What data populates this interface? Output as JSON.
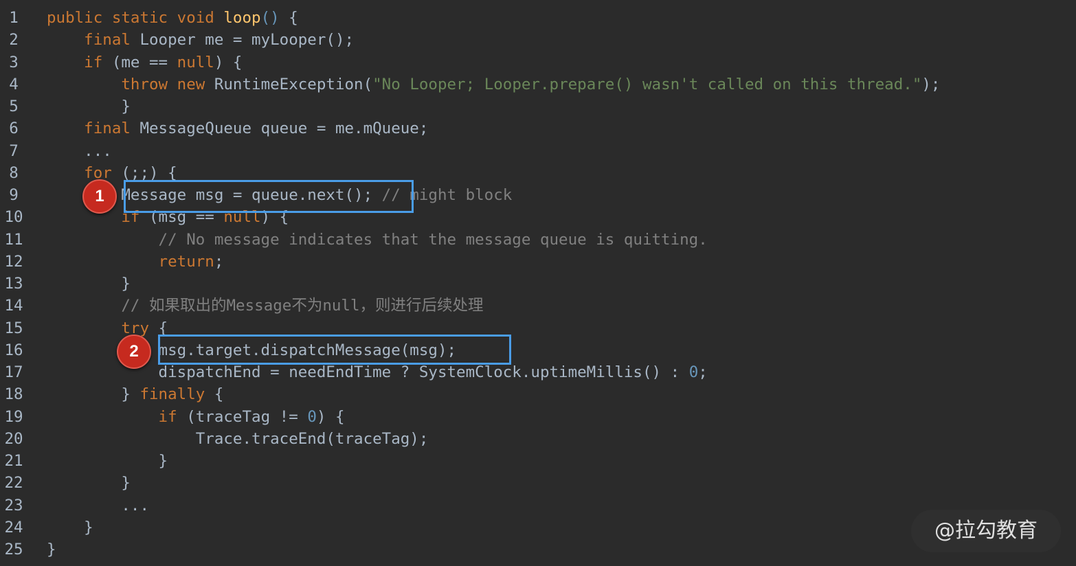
{
  "editor": {
    "theme": {
      "background": "#2b2b2b",
      "keyword": "#cc7832",
      "function": "#ffc66d",
      "string": "#6a8759",
      "number": "#6897bb",
      "comment": "#808080",
      "text": "#a9b7c6",
      "highlight_border": "#4a9de8",
      "marker_fill": "#c62a1f"
    },
    "lines": [
      {
        "n": "1",
        "tokens": [
          {
            "t": "public static void ",
            "c": "kw"
          },
          {
            "t": "loop",
            "c": "fn"
          },
          {
            "t": "()",
            "c": "paren"
          },
          {
            "t": " {",
            "c": "plain"
          }
        ]
      },
      {
        "n": "2",
        "tokens": [
          {
            "t": "    final ",
            "c": "kw"
          },
          {
            "t": "Looper me = myLooper();",
            "c": "plain"
          }
        ]
      },
      {
        "n": "3",
        "tokens": [
          {
            "t": "    if ",
            "c": "kw"
          },
          {
            "t": "(me == ",
            "c": "plain"
          },
          {
            "t": "null",
            "c": "kw"
          },
          {
            "t": ") {",
            "c": "plain"
          }
        ]
      },
      {
        "n": "4",
        "tokens": [
          {
            "t": "        throw new ",
            "c": "kw"
          },
          {
            "t": "RuntimeException(",
            "c": "plain"
          },
          {
            "t": "\"No Looper; Looper.prepare() wasn't called on this thread.\"",
            "c": "str"
          },
          {
            "t": ");",
            "c": "plain"
          }
        ]
      },
      {
        "n": "5",
        "tokens": [
          {
            "t": "        }",
            "c": "plain"
          }
        ]
      },
      {
        "n": "6",
        "tokens": [
          {
            "t": "    final ",
            "c": "kw"
          },
          {
            "t": "MessageQueue queue = me.mQueue;",
            "c": "plain"
          }
        ]
      },
      {
        "n": "7",
        "tokens": [
          {
            "t": "    ...",
            "c": "plain"
          }
        ]
      },
      {
        "n": "8",
        "tokens": [
          {
            "t": "    for ",
            "c": "kw"
          },
          {
            "t": "(;;) {",
            "c": "plain"
          }
        ]
      },
      {
        "n": "9",
        "tokens": [
          {
            "t": "        Message msg = queue.next(); ",
            "c": "plain"
          },
          {
            "t": "// might block",
            "c": "cmt"
          }
        ]
      },
      {
        "n": "10",
        "tokens": [
          {
            "t": "        if ",
            "c": "kw"
          },
          {
            "t": "(msg == ",
            "c": "plain"
          },
          {
            "t": "null",
            "c": "kw"
          },
          {
            "t": ") {",
            "c": "plain"
          }
        ]
      },
      {
        "n": "11",
        "tokens": [
          {
            "t": "            // No message indicates that the message queue is quitting.",
            "c": "cmt"
          }
        ]
      },
      {
        "n": "12",
        "tokens": [
          {
            "t": "            return",
            "c": "kw"
          },
          {
            "t": ";",
            "c": "plain"
          }
        ]
      },
      {
        "n": "13",
        "tokens": [
          {
            "t": "        }",
            "c": "plain"
          }
        ]
      },
      {
        "n": "14",
        "tokens": [
          {
            "t": "        // 如果取出的Message不为null，则进行后续处理",
            "c": "cmt"
          }
        ]
      },
      {
        "n": "15",
        "tokens": [
          {
            "t": "        try ",
            "c": "kw"
          },
          {
            "t": "{",
            "c": "plain"
          }
        ]
      },
      {
        "n": "16",
        "tokens": [
          {
            "t": "            msg.target.dispatchMessage(msg);",
            "c": "plain"
          }
        ]
      },
      {
        "n": "17",
        "tokens": [
          {
            "t": "            dispatchEnd = needEndTime ? SystemClock.uptimeMillis() : ",
            "c": "plain"
          },
          {
            "t": "0",
            "c": "num"
          },
          {
            "t": ";",
            "c": "plain"
          }
        ]
      },
      {
        "n": "18",
        "tokens": [
          {
            "t": "        } ",
            "c": "plain"
          },
          {
            "t": "finally ",
            "c": "kw"
          },
          {
            "t": "{",
            "c": "plain"
          }
        ]
      },
      {
        "n": "19",
        "tokens": [
          {
            "t": "            if ",
            "c": "kw"
          },
          {
            "t": "(traceTag != ",
            "c": "plain"
          },
          {
            "t": "0",
            "c": "num"
          },
          {
            "t": ") {",
            "c": "plain"
          }
        ]
      },
      {
        "n": "20",
        "tokens": [
          {
            "t": "                Trace.traceEnd(traceTag);",
            "c": "plain"
          }
        ]
      },
      {
        "n": "21",
        "tokens": [
          {
            "t": "            }",
            "c": "plain"
          }
        ]
      },
      {
        "n": "22",
        "tokens": [
          {
            "t": "        }",
            "c": "plain"
          }
        ]
      },
      {
        "n": "23",
        "tokens": [
          {
            "t": "        ...",
            "c": "plain"
          }
        ]
      },
      {
        "n": "24",
        "tokens": [
          {
            "t": "    }",
            "c": "plain"
          }
        ]
      },
      {
        "n": "25",
        "tokens": [
          {
            "t": "}",
            "c": "plain"
          }
        ]
      }
    ]
  },
  "annotations": [
    {
      "label": "1",
      "line": "9"
    },
    {
      "label": "2",
      "line": "16"
    }
  ],
  "watermark": {
    "text": "@拉勾教育"
  }
}
